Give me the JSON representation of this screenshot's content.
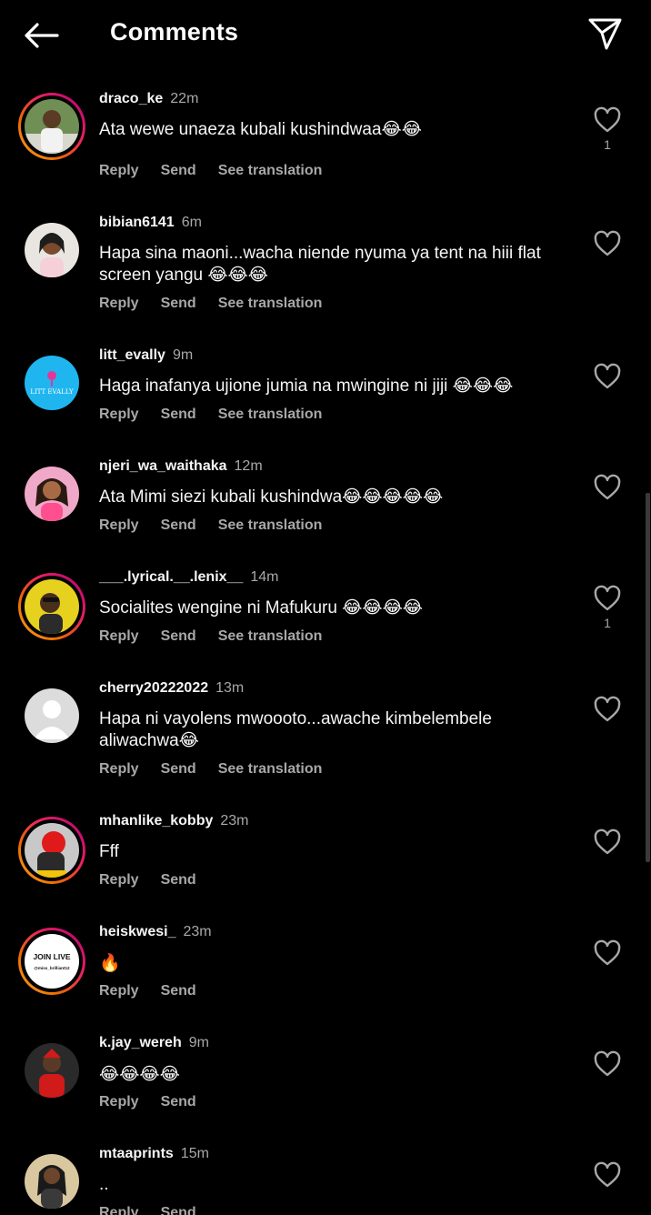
{
  "header": {
    "title": "Comments"
  },
  "comments": [
    {
      "username": "draco_ke",
      "time": "22m",
      "text": "Ata wewe unaeza kubali kushindwaa😂😂",
      "reply": "Reply",
      "send": "Send",
      "translate": "See translation",
      "likes": "1"
    },
    {
      "username": "bibian6141",
      "time": "6m",
      "text": "Hapa sina maoni...wacha niende nyuma ya tent na hiii flat screen yangu 😂😂😂",
      "reply": "Reply",
      "send": "Send",
      "translate": "See translation",
      "likes": ""
    },
    {
      "username": "litt_evally",
      "time": "9m",
      "text": "Haga inafanya ujione jumia na mwingine ni jiji 😂😂😂",
      "reply": "Reply",
      "send": "Send",
      "translate": "See translation",
      "likes": ""
    },
    {
      "username": "njeri_wa_waithaka",
      "time": "12m",
      "text": "Ata Mimi siezi kubali kushindwa😂😂😂😂😂",
      "reply": "Reply",
      "send": "Send",
      "translate": "See translation",
      "likes": ""
    },
    {
      "username": "___.lyrical.__.lenix__",
      "time": "14m",
      "text": "Socialites wengine ni Mafukuru 😂😂😂😂",
      "reply": "Reply",
      "send": "Send",
      "translate": "See translation",
      "likes": "1"
    },
    {
      "username": "cherry20222022",
      "time": "13m",
      "text": "Hapa ni vayolens mwoooto...awache kimbelembele aliwachwa😂",
      "reply": "Reply",
      "send": "Send",
      "translate": "See translation",
      "likes": ""
    },
    {
      "username": "mhanlike_kobby",
      "time": "23m",
      "text": "Fff",
      "reply": "Reply",
      "send": "Send",
      "likes": ""
    },
    {
      "username": "heiskwesi_",
      "time": "23m",
      "text": "🔥",
      "reply": "Reply",
      "send": "Send",
      "avatar_text": "JOIN LIVE",
      "avatar_subtext": "@miss_brilliant12",
      "likes": ""
    },
    {
      "username": "k.jay_wereh",
      "time": "9m",
      "text": "😂😂😂😂",
      "reply": "Reply",
      "send": "Send",
      "likes": ""
    },
    {
      "username": "mtaaprints",
      "time": "15m",
      "text": "..",
      "reply": "Reply",
      "send": "Send",
      "likes": ""
    }
  ],
  "avatar_text_small": "LITT EVALLY",
  "colors": {
    "background": "#000000",
    "text_primary": "#f5f5f5",
    "text_secondary": "#a8a8a8",
    "story_ring_start": "#f9a825",
    "story_ring_end": "#b0007a"
  }
}
